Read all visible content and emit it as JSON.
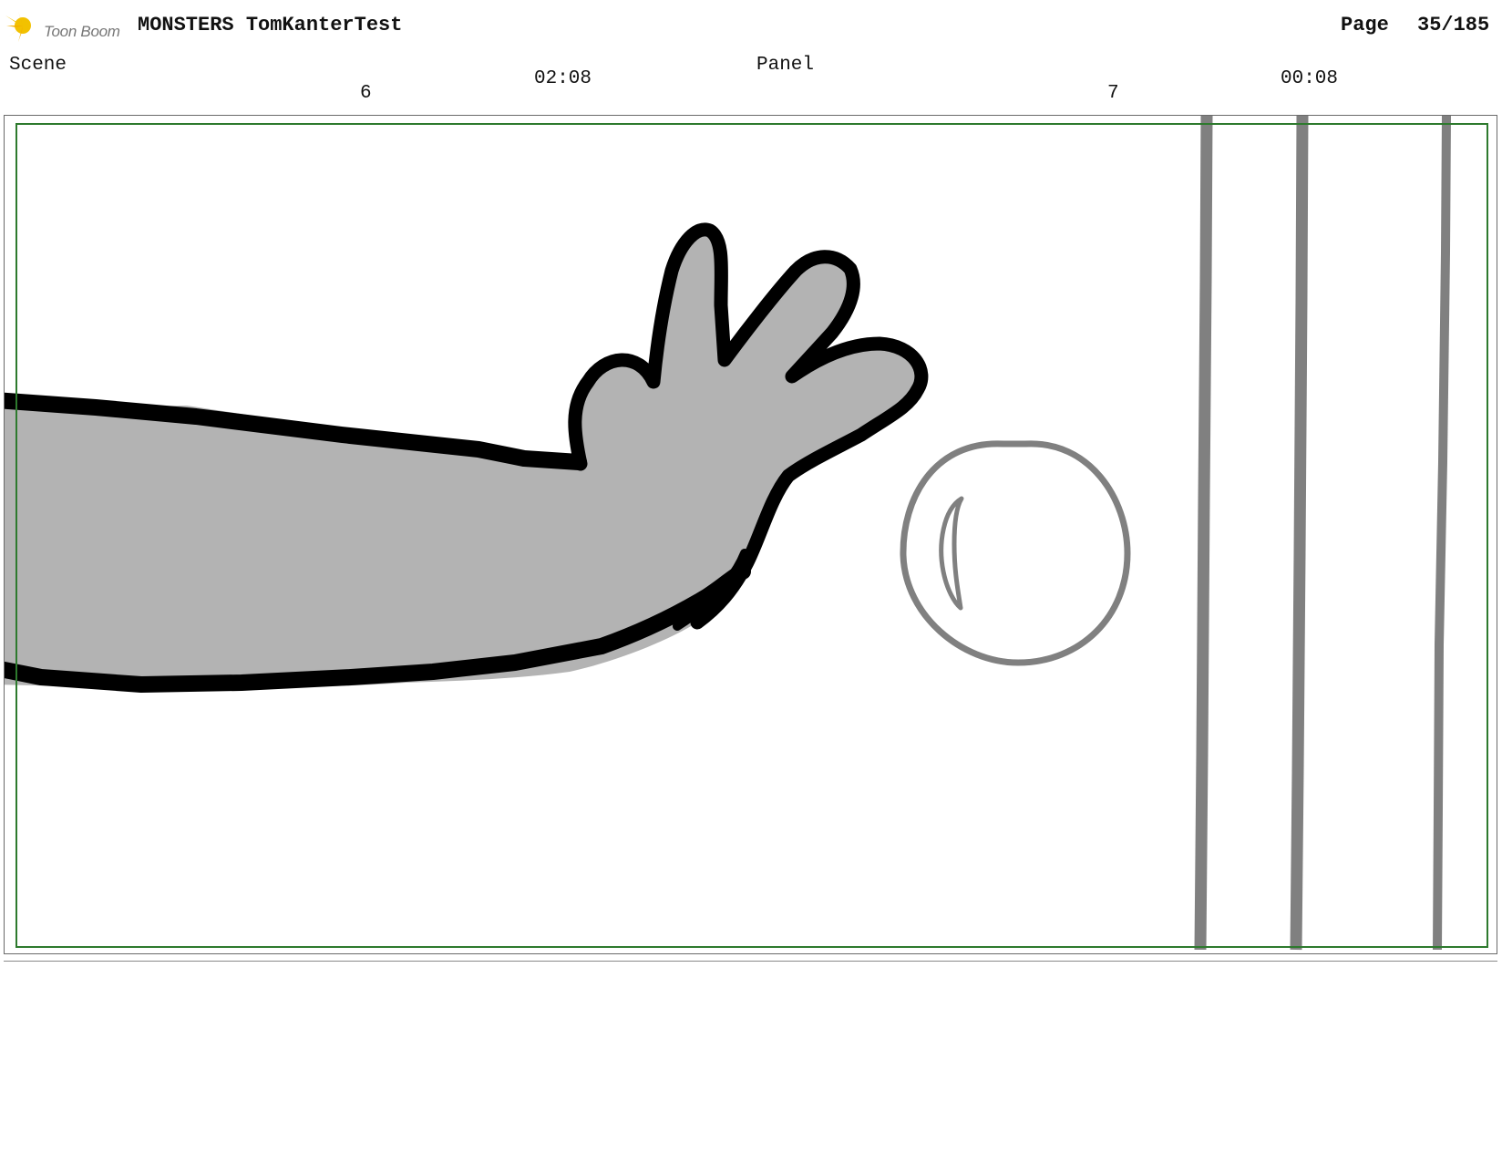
{
  "header": {
    "logo_text": "Toon Boom",
    "project_title": "MONSTERS TomKanterTest",
    "page_label": "Page",
    "page_number": "35/185"
  },
  "scene": {
    "label": "Scene",
    "number": "6",
    "duration": "02:08"
  },
  "panel": {
    "label": "Panel",
    "number": "7",
    "duration": "00:08"
  },
  "colors": {
    "safe_area_border": "#2e7a2e",
    "arm_fill": "#b3b3b3",
    "outline": "#000000",
    "bubble_stroke": "#808080",
    "logo_accent": "#f2c100"
  },
  "drawing": {
    "subjects": [
      "reaching-arm",
      "bubble",
      "bars"
    ]
  },
  "notes": {
    "text": ""
  }
}
